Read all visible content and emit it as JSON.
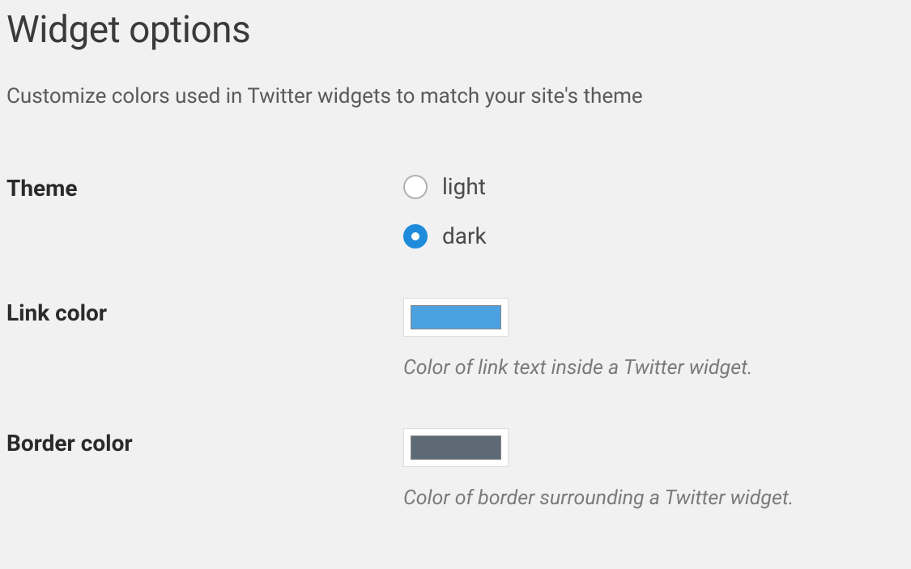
{
  "page": {
    "title": "Widget options",
    "description": "Customize colors used in Twitter widgets to match your site's theme"
  },
  "theme": {
    "label": "Theme",
    "options": [
      {
        "value": "light",
        "label": "light",
        "selected": false
      },
      {
        "value": "dark",
        "label": "dark",
        "selected": true
      }
    ]
  },
  "linkColor": {
    "label": "Link color",
    "value": "#4ca2e0",
    "help": "Color of link text inside a Twitter widget."
  },
  "borderColor": {
    "label": "Border color",
    "value": "#5d6a76",
    "help": "Color of border surrounding a Twitter widget."
  }
}
